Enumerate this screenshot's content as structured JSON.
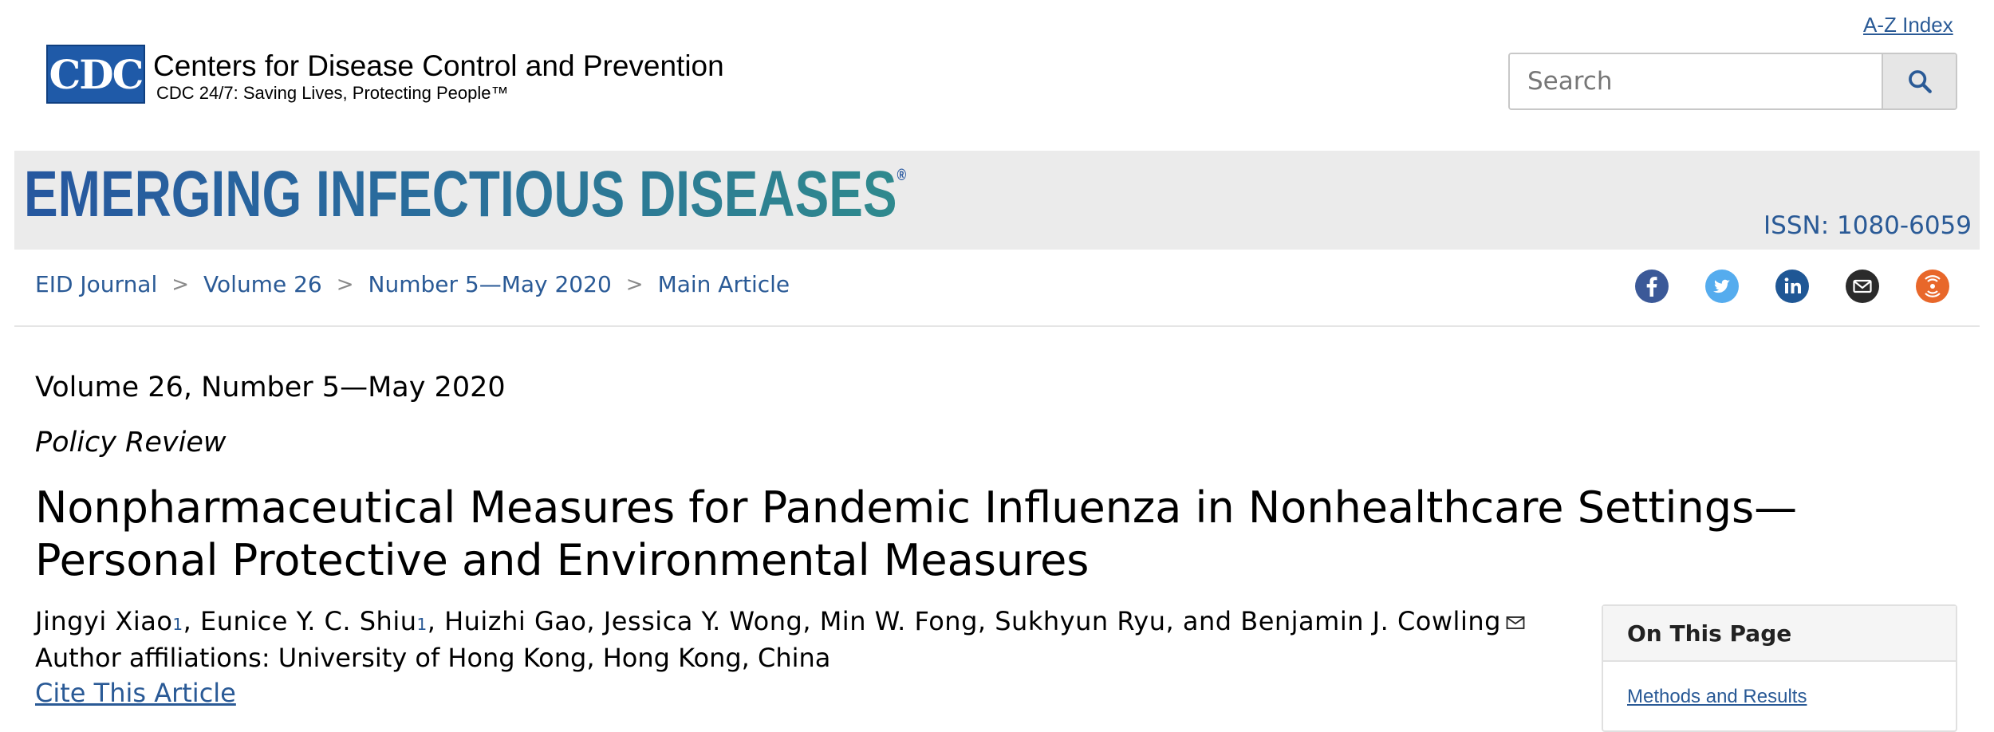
{
  "header": {
    "az_index": "A-Z Index",
    "logo_text": "CDC",
    "org_name": "Centers for Disease Control and Prevention",
    "tagline": "CDC 24/7: Saving Lives, Protecting People™",
    "search_placeholder": "Search"
  },
  "banner": {
    "journal_name": "EMERGING INFECTIOUS DISEASES",
    "registered_mark": "®",
    "issn": "ISSN: 1080-6059"
  },
  "breadcrumb": {
    "items": [
      "EID Journal",
      "Volume 26",
      "Number 5—May 2020",
      "Main Article"
    ],
    "separator": ">"
  },
  "social": {
    "icons": [
      "facebook-icon",
      "twitter-icon",
      "linkedin-icon",
      "email-icon",
      "syndicate-icon"
    ],
    "colors": {
      "facebook": "#3b5998",
      "twitter": "#55acee",
      "linkedin": "#1f5795",
      "email": "#2b2b2b",
      "syndicate": "#e8672a"
    }
  },
  "article": {
    "issue": "Volume 26, Number 5—May 2020",
    "type": "Policy Review",
    "title": "Nonpharmaceutical Measures for Pandemic Influenza in Nonhealthcare Settings—Personal Protective and Environmental Measures",
    "authors": [
      {
        "name": "Jingyi Xiao",
        "sup": "1"
      },
      {
        "name": "Eunice Y. C. Shiu",
        "sup": "1"
      },
      {
        "name": "Huizhi Gao",
        "sup": ""
      },
      {
        "name": "Jessica Y. Wong",
        "sup": ""
      },
      {
        "name": "Min W. Fong",
        "sup": ""
      },
      {
        "name": "Sukhyun Ryu",
        "sup": ""
      },
      {
        "name": "Benjamin J. Cowling",
        "sup": ""
      }
    ],
    "authors_sep": ", ",
    "authors_last_sep": ", and ",
    "affiliations": "Author affiliations: University of Hong Kong, Hong Kong, China",
    "cite": "Cite This Article"
  },
  "on_this_page": {
    "heading": "On This Page",
    "links": [
      "Methods and Results"
    ]
  },
  "colors": {
    "link": "#2a5a96",
    "banner_bg": "#ebebeb",
    "cdc_blue": "#1f5aa8"
  }
}
